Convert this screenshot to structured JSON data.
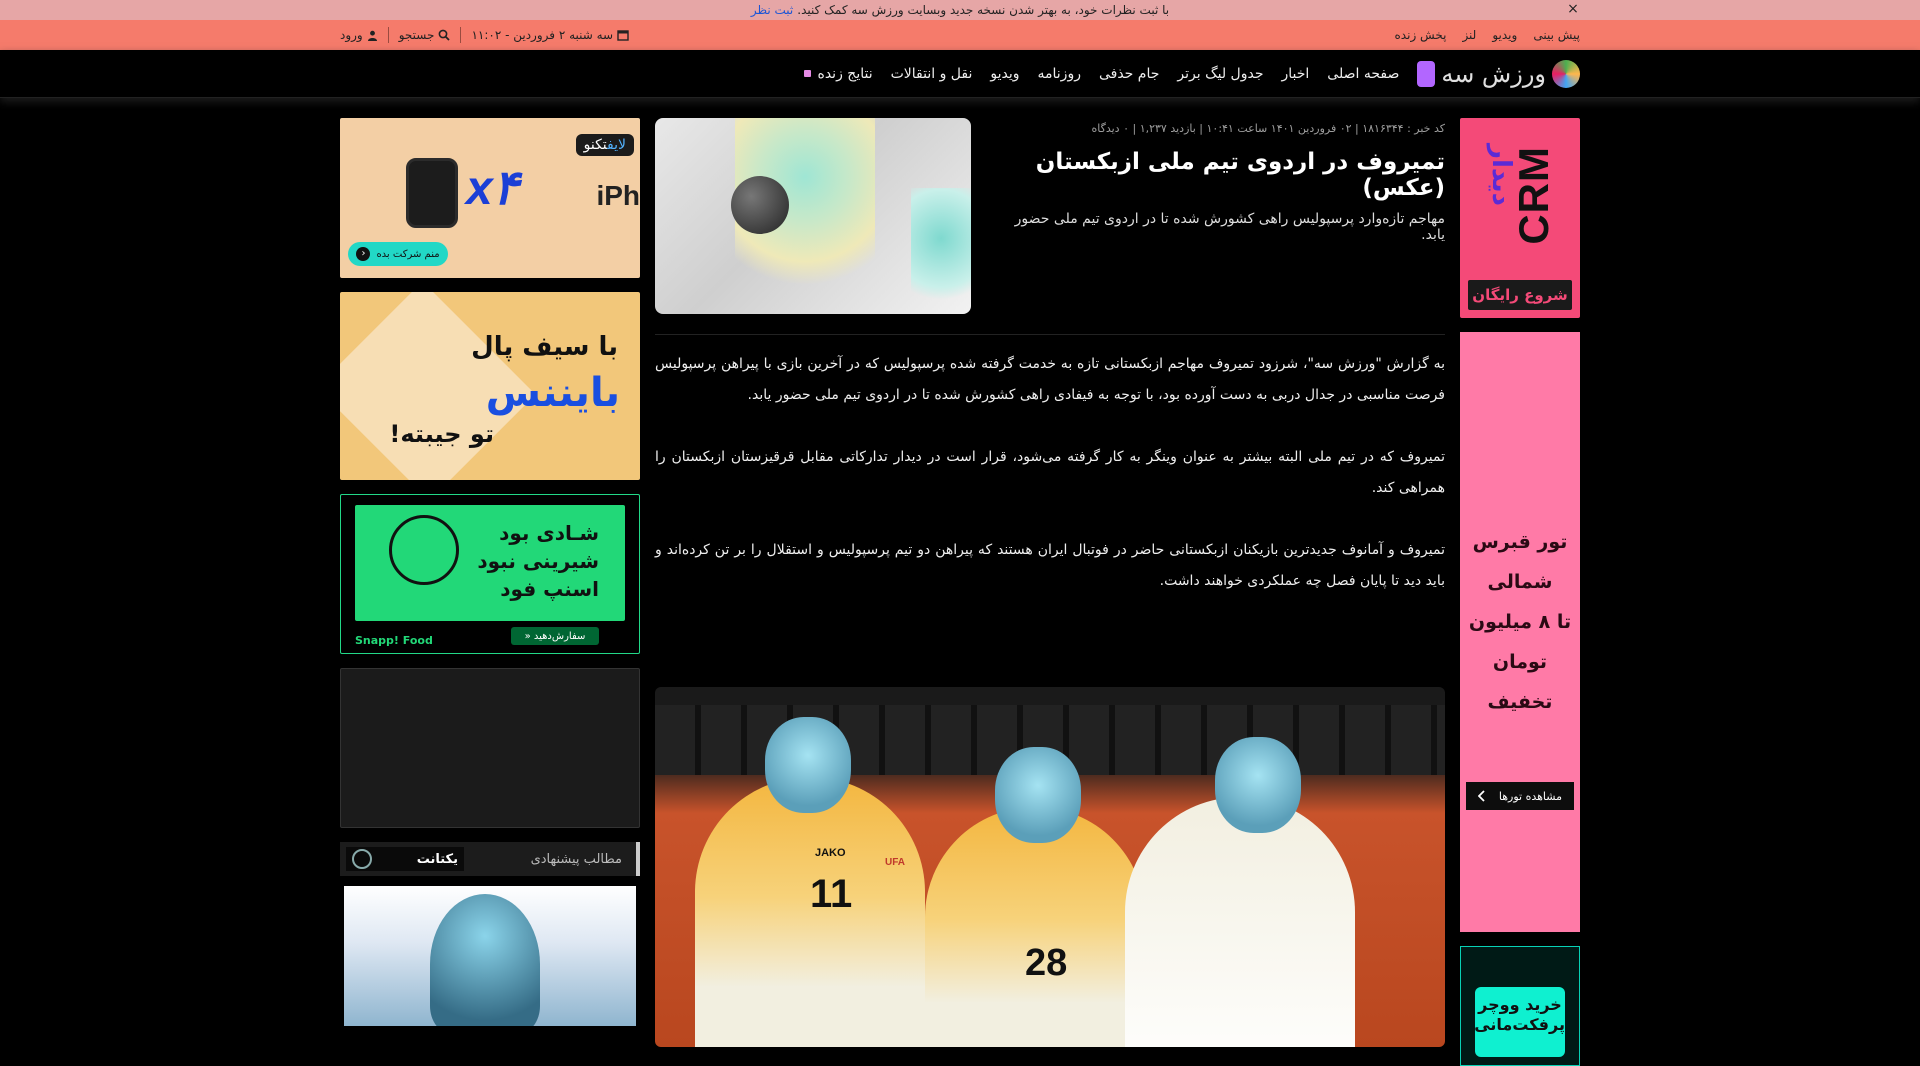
{
  "notice": {
    "text": "با ثبت نظرات خود، به بهتر شدن نسخه جدید وبسایت ورزش سه کمک کنید.",
    "link": "ثبت نظر",
    "close": "×"
  },
  "topstrip": {
    "links": [
      "پیش بینی",
      "ویدیو",
      "لنز",
      "پخش زنده"
    ],
    "date": "سه شنبه ۲ فروردین - ۱۱:۰۲",
    "search": "جستجو",
    "login": "ورود"
  },
  "nav": {
    "logo": "ورزش سه",
    "items": [
      "صفحه اصلی",
      "اخبار",
      "جدول لیگ برتر",
      "جام حذفی",
      "روزنامه",
      "ویدیو",
      "نقل و انتقالات"
    ],
    "live": "نتایج زنده"
  },
  "article": {
    "meta": "کد خبر : ۱۸۱۶۳۴۴ | ۰۲ فروردین ۱۴۰۱ ساعت ۱۰:۴۱ | بازدید ۱,۲۳۷ | ۰ دیدگاه",
    "title": "تمیروف در اردوی تیم ملی ازبکستان (عکس)",
    "lead": "مهاجم تازه‌وارد پرسپولیس راهی کشورش شده تا در اردوی تیم ملی حضور یابد.",
    "paragraphs": [
      "به گزارش \"ورزش سه\"، شرزود تمیروف مهاجم ازبکستانی تازه به خدمت گرفته شده پرسپولیس که در آخرین بازی با پیراهن پرسپولیس فرصت مناسبی در جدال دربی به دست آورده بود، با توجه به فیفادی راهی کشورش شده تا در اردوی تیم ملی حضور یابد.",
      "تمیروف که در تیم ملی البته بیشتر به عنوان وینگر به کار گرفته می‌شود، قرار است در دیدار تدارکاتی مقابل قرقیزستان ازبکستان را همراهی کند.",
      "تمیروف و آمانوف جدیدترین بازیکنان ازبکستانی حاضر در فوتبال ایران هستند که پیراهن دو تیم پرسپولیس و استقلال را بر تن کرده‌اند و باید دید تا پایان فصل چه عملکردی خواهند داشت."
    ],
    "photo_numbers": [
      "11",
      "28"
    ],
    "photo_labels": [
      "JAKO",
      "UFA"
    ]
  },
  "right_ads": {
    "crm_word": "CRM",
    "crm_sub": "دیدار",
    "crm_btn": "شروع رایگان",
    "tour_lines": [
      "تور قبرس شمالی",
      "تا ۸ میلیون تومان",
      "تخفیف"
    ],
    "tour_btn": "مشاهده تورها",
    "voucher_lines": [
      "خرید ووچر",
      "پرفکت‌مانی"
    ]
  },
  "left_ads": {
    "ad1_brand_a": "تکنو",
    "ad1_brand_b": "لایف",
    "ad1_x4": "x۴",
    "ad1_iph": "iPh",
    "ad1_cta": "منم شرکت بده",
    "ad2_t1": "با سیف پال",
    "ad2_t2": "بایننس",
    "ad2_t3": "تو جیبته!",
    "ad3_lines": [
      "شـادی بود",
      "شیرینی نبود",
      "اسنپ فود"
    ],
    "ad3_logo": "Snapp! Food",
    "ad3_order": "سفارش‌دهید «"
  },
  "suggestions": {
    "label": "مطالب پیشنهادی",
    "brand": "یکتانت"
  }
}
